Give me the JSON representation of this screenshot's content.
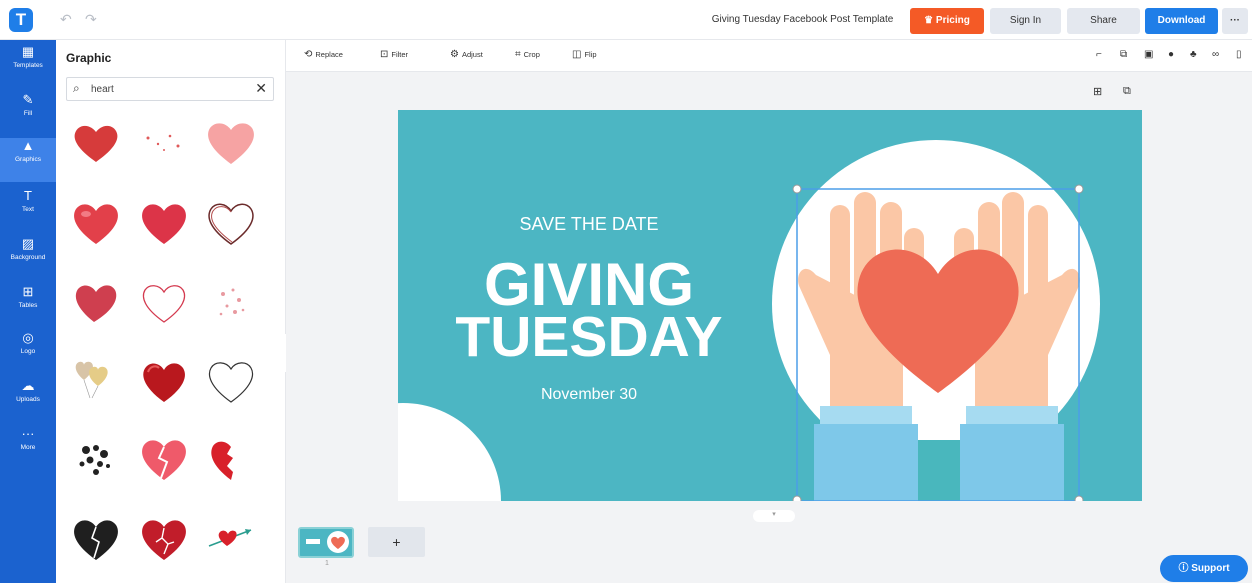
{
  "topbar": {
    "logo_letter": "T",
    "undo_icon": "↶",
    "redo_icon": "↷",
    "doc_title": "Giving Tuesday Facebook Post Template",
    "pricing_label": "Pricing",
    "signin_label": "Sign In",
    "share_label": "Share",
    "download_label": "Download",
    "more_label": "···"
  },
  "nav": [
    {
      "label": "Templates",
      "icon": "▦"
    },
    {
      "label": "Fill",
      "icon": "✎"
    },
    {
      "label": "Graphics",
      "icon": "▲"
    },
    {
      "label": "Text",
      "icon": "T"
    },
    {
      "label": "Background",
      "icon": "▨"
    },
    {
      "label": "Tables",
      "icon": "⊞"
    },
    {
      "label": "Logo",
      "icon": "◎"
    },
    {
      "label": "Uploads",
      "icon": "☁"
    },
    {
      "label": "More",
      "icon": "···"
    }
  ],
  "panel": {
    "title": "Graphic",
    "search_value": "heart",
    "search_icon": "⌕",
    "clear_icon": "✕",
    "collapse_icon": "‹"
  },
  "toolbar": {
    "replace_label": "Replace",
    "filter_label": "Filter",
    "adjust_label": "Adjust",
    "crop_label": "Crop",
    "flip_label": "Flip"
  },
  "canvas": {
    "save_the_date": "SAVE THE DATE",
    "line1": "GIVING",
    "line2": "TUESDAY",
    "date": "November 30",
    "bg_color": "#4cb6c3",
    "heart_color": "#ee6b55",
    "hand_color": "#fbc7a6",
    "sleeve_color": "#7ec8e9"
  },
  "pages": {
    "page_number": "1",
    "add_label": "+"
  },
  "support_label": "Support"
}
